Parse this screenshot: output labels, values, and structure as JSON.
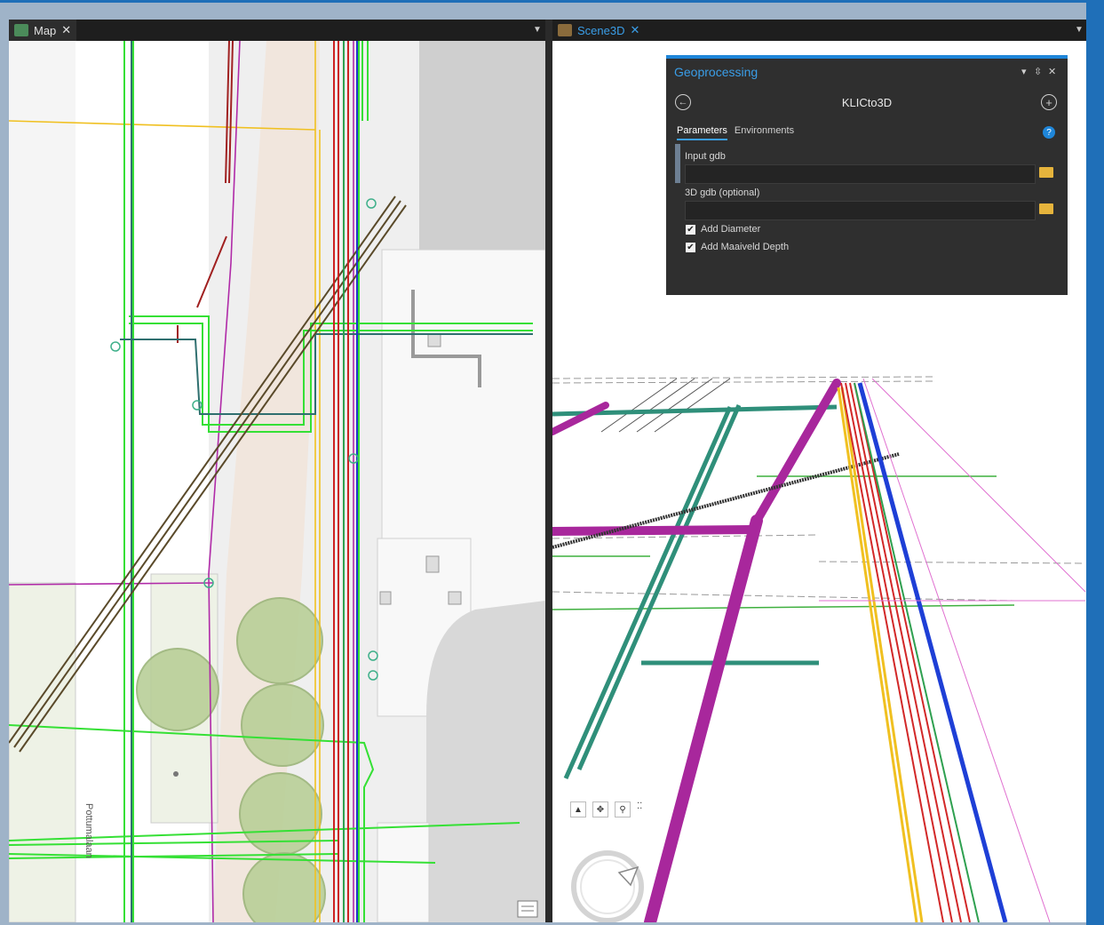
{
  "left_pane": {
    "tab_label": "Map",
    "tab_close": "✕",
    "street_label": "Pottumalaan",
    "colors": {
      "tab_bg": "#1e1e1e",
      "text": "#e0e0e0"
    }
  },
  "right_pane": {
    "tab_label": "Scene3D",
    "tab_close": "✕",
    "colors": {
      "tab_text": "#3a9ee8"
    }
  },
  "geoprocessing": {
    "title": "Geoprocessing",
    "window_controls": [
      "▾",
      "⇳",
      "✕"
    ],
    "tool_name": "KLICto3D",
    "tabs": [
      "Parameters",
      "Environments"
    ],
    "active_tab": "Parameters",
    "help_icon": "?",
    "parameters": [
      {
        "label": "Input gdb",
        "value": ""
      },
      {
        "label": "3D gdb (optional)",
        "value": ""
      }
    ],
    "checkboxes": [
      {
        "label": "Add Diameter",
        "checked": true
      },
      {
        "label": "Add Maaiveld Depth",
        "checked": true
      }
    ]
  },
  "colors": {
    "accent": "#1f86d9",
    "pipe_magenta": "#a8279c",
    "pipe_teal": "#2f8f7a",
    "pipe_red": "#d22828",
    "pipe_blue": "#1e3fd6",
    "pipe_yellow": "#f0c020",
    "pipe_green": "#2fe02f"
  }
}
